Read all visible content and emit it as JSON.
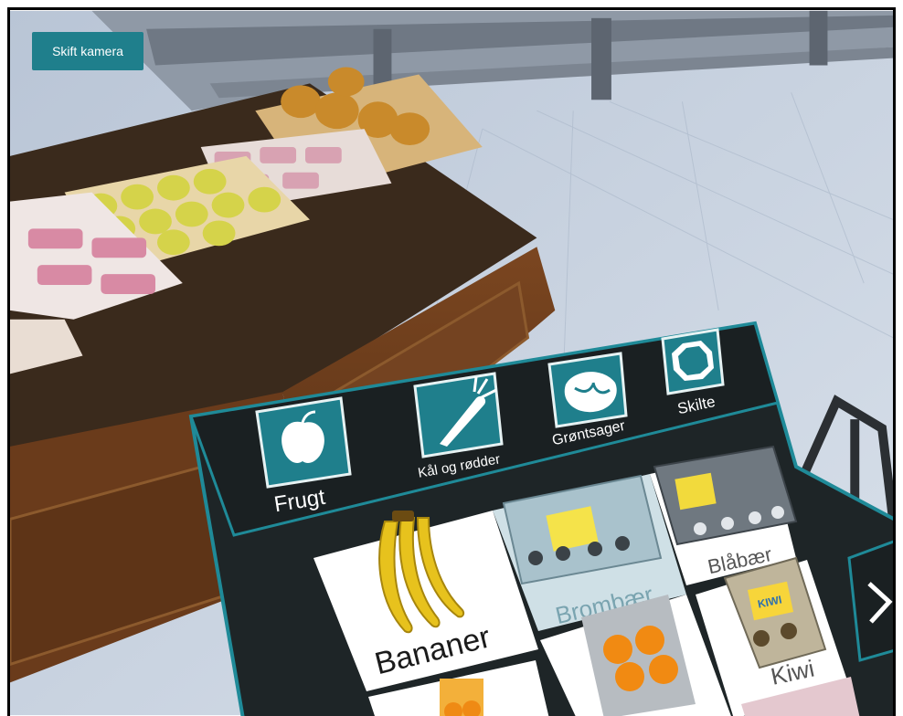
{
  "camera_button": {
    "label": "Skift kamera"
  },
  "category_tabs": [
    {
      "label": "Frugt",
      "icon": "apple-icon"
    },
    {
      "label": "Kål og rødder",
      "icon": "carrot-icon"
    },
    {
      "label": "Grøntsager",
      "icon": "cabbage-icon"
    },
    {
      "label": "Skilte",
      "icon": "octagon-sign-icon"
    }
  ],
  "products": [
    {
      "label": "Bananer"
    },
    {
      "label": "Brombær"
    },
    {
      "label": "Blåbær"
    },
    {
      "label": "Kiwi"
    }
  ],
  "colors": {
    "accent": "#1f7f8c",
    "panel": "#1e2527",
    "floor": "#c9d4e2",
    "crate": "#6e3f1c"
  }
}
